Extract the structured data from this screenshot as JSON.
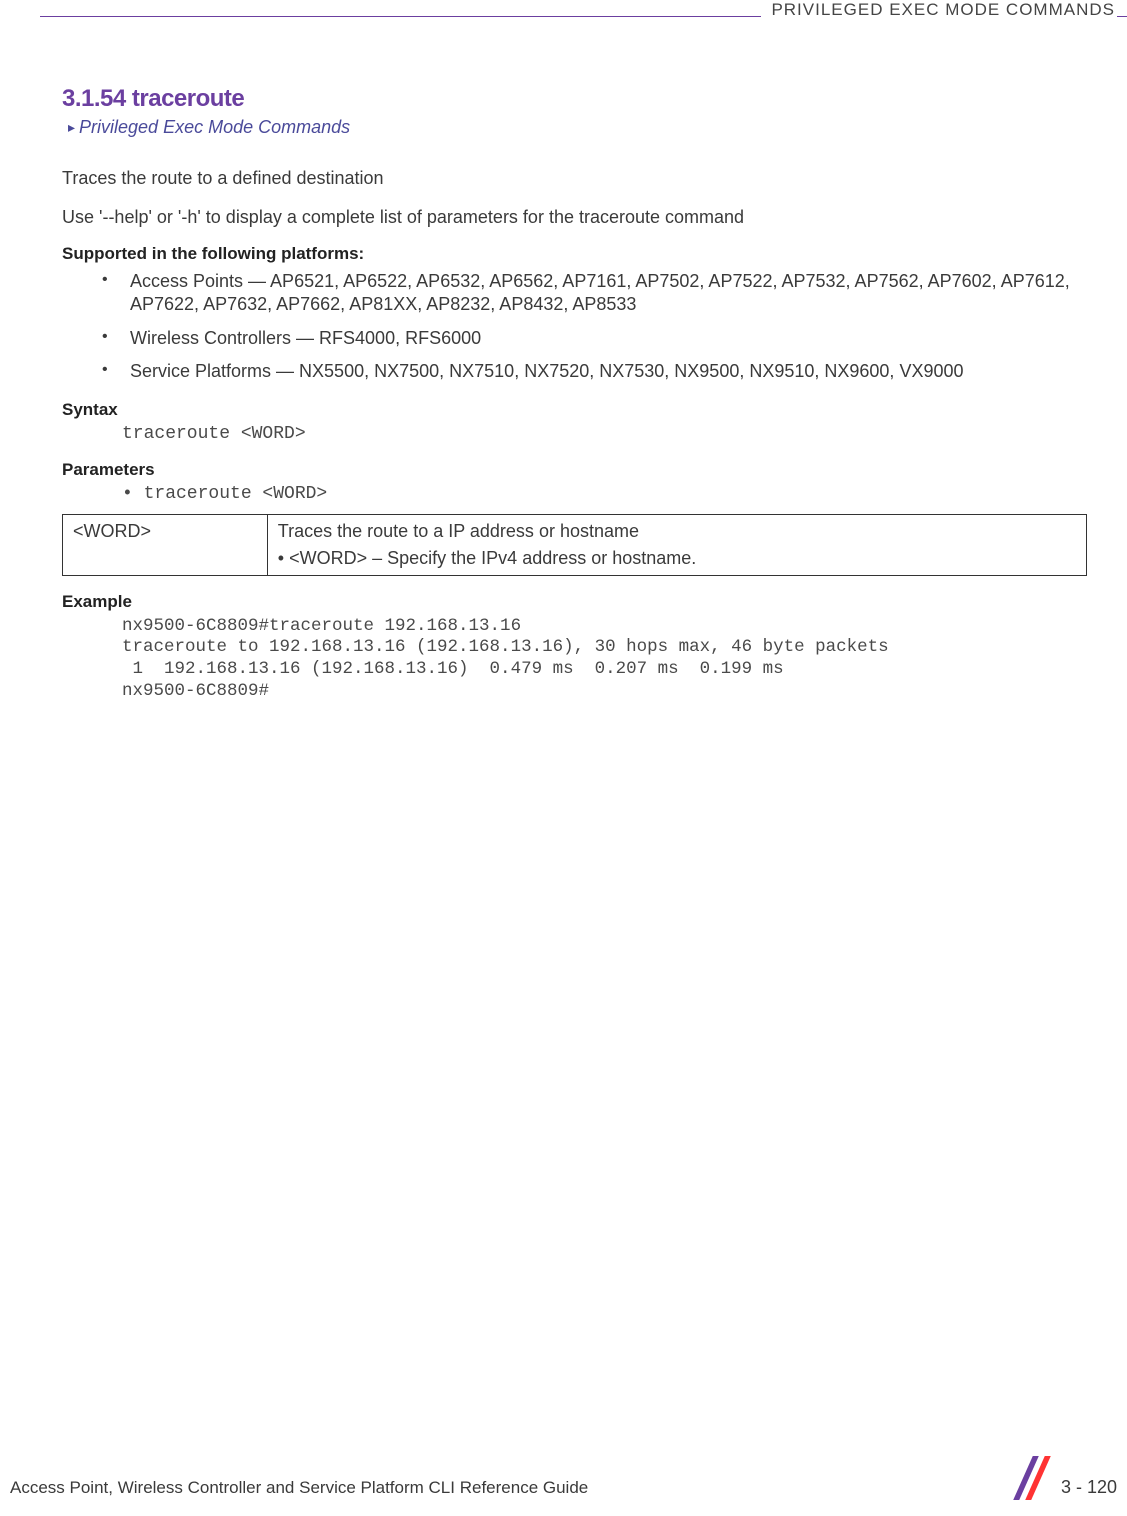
{
  "header": {
    "text": "PRIVILEGED EXEC MODE COMMANDS"
  },
  "section": {
    "number_title": "3.1.54 traceroute",
    "breadcrumb": "Privileged Exec Mode Commands",
    "intro": "Traces the route to a defined destination",
    "note": "Use '--help' or '-h' to display a complete list of parameters for the traceroute command"
  },
  "supported": {
    "heading": "Supported in the following platforms:",
    "items": [
      "Access Points — AP6521, AP6522, AP6532, AP6562, AP7161, AP7502, AP7522, AP7532, AP7562, AP7602, AP7612, AP7622, AP7632, AP7662, AP81XX, AP8232, AP8432, AP8533",
      "Wireless Controllers — RFS4000, RFS6000",
      "Service Platforms — NX5500, NX7500, NX7510, NX7520, NX7530, NX9500, NX9510, NX9600, VX9000"
    ]
  },
  "syntax": {
    "heading": "Syntax",
    "code": "traceroute <WORD>"
  },
  "parameters": {
    "heading": "Parameters",
    "bullet": "• traceroute <WORD>",
    "table": {
      "param": "<WORD>",
      "desc_main": "Traces the route to a IP address or hostname",
      "desc_sub": "•  <WORD> – Specify the IPv4 address or hostname."
    }
  },
  "example": {
    "heading": "Example",
    "code": "nx9500-6C8809#traceroute 192.168.13.16\ntraceroute to 192.168.13.16 (192.168.13.16), 30 hops max, 46 byte packets\n 1  192.168.13.16 (192.168.13.16)  0.479 ms  0.207 ms  0.199 ms\nnx9500-6C8809#"
  },
  "footer": {
    "guide": "Access Point, Wireless Controller and Service Platform CLI Reference Guide",
    "page": "3 - 120"
  }
}
